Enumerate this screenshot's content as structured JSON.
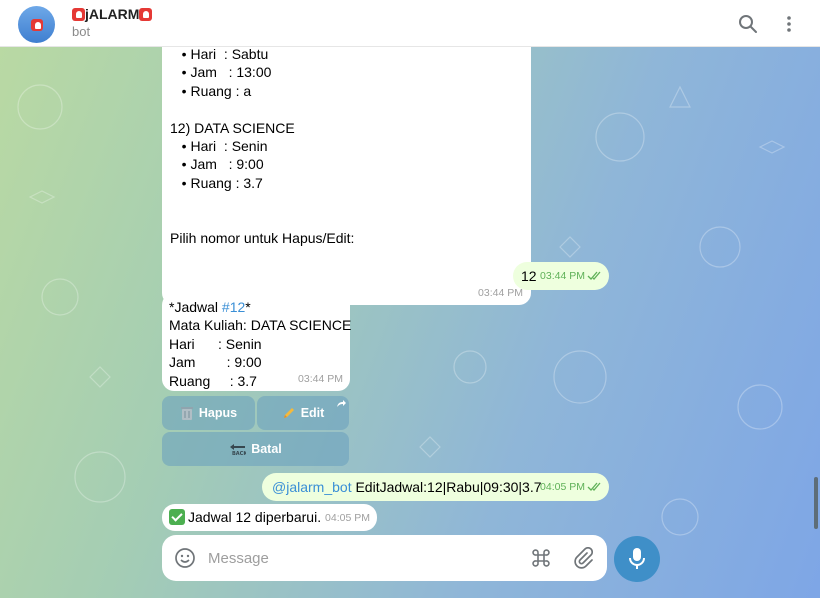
{
  "header": {
    "title": "jALARM",
    "subtitle": "bot"
  },
  "colors": {
    "accent": "#3f8fc8",
    "outgoing_bubble": "#eeffde",
    "incoming_bubble": "#ffffff",
    "time_incoming": "#a0a0a0",
    "time_outgoing": "#5fb158",
    "alarm_red": "#e53935"
  },
  "messages": {
    "schedule": {
      "lines": [
        "   • Hari  : Sabtu",
        "   • Jam   : 13:00",
        "   • Ruang : a",
        "",
        "12) DATA SCIENCE",
        "   • Hari  : Senin",
        "   • Jam   : 9:00",
        "   • Ruang : 3.7",
        "",
        "",
        "Pilih nomor untuk Hapus/Edit:"
      ],
      "time": "03:44 PM"
    },
    "user_reply": {
      "text": "12",
      "time": "03:44 PM"
    },
    "detail": {
      "title_prefix": "*Jadwal ",
      "title_hash": "#12",
      "title_suffix": "*",
      "lines": [
        "Mata Kuliah: DATA SCIENCE",
        "Hari      : Senin",
        "Jam        : 9:00",
        "Ruang     : 3.7"
      ],
      "time": "03:44 PM"
    },
    "keyboard": {
      "delete_label": "Hapus",
      "edit_label": "Edit",
      "cancel_label": "Batal"
    },
    "edit_command": {
      "mention": "@jalarm_bot",
      "text": " EditJadwal:12|Rabu|09:30|3.7",
      "time": "04:05 PM"
    },
    "confirmation": {
      "text": "Jadwal 12 diperbarui.",
      "time": "04:05 PM"
    }
  },
  "composer": {
    "placeholder": "Message"
  },
  "icons": {
    "search": "search-icon",
    "menu": "more-vertical-icon",
    "emoji": "emoji-icon",
    "command": "command-icon",
    "attach": "paperclip-icon",
    "mic": "microphone-icon"
  }
}
